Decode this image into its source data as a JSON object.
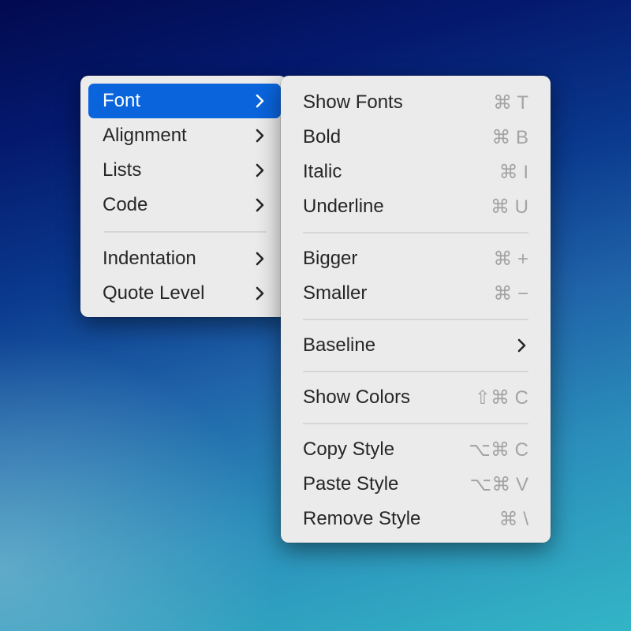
{
  "main_menu": {
    "groups": [
      [
        {
          "label": "Font",
          "selected": true,
          "submenu": true
        },
        {
          "label": "Alignment",
          "submenu": true
        },
        {
          "label": "Lists",
          "submenu": true
        },
        {
          "label": "Code",
          "submenu": true
        }
      ],
      [
        {
          "label": "Indentation",
          "submenu": true
        },
        {
          "label": "Quote Level",
          "submenu": true
        }
      ]
    ]
  },
  "font_submenu": {
    "items": [
      {
        "label": "Show Fonts",
        "shortcut": "⌘ T"
      },
      {
        "label": "Bold",
        "shortcut": "⌘ B"
      },
      {
        "label": "Italic",
        "shortcut": "⌘ I"
      },
      {
        "label": "Underline",
        "shortcut": "⌘ U"
      },
      {
        "label": "Bigger",
        "shortcut": "⌘ +"
      },
      {
        "label": "Smaller",
        "shortcut": "⌘ −"
      },
      {
        "label": "Baseline",
        "submenu": true
      },
      {
        "label": "Show Colors",
        "shortcut": "⇧⌘ C"
      },
      {
        "label": "Copy Style",
        "shortcut": "⌥⌘ C"
      },
      {
        "label": "Paste Style",
        "shortcut": "⌥⌘ V"
      },
      {
        "label": "Remove Style",
        "shortcut": "⌘ \\"
      }
    ]
  },
  "colors": {
    "selection": "#0a64dc",
    "menu_background": "#ebebeb",
    "shortcut_text": "#a3a3a3"
  }
}
